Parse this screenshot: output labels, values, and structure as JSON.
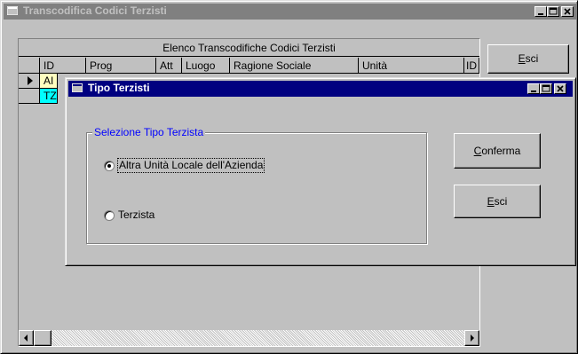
{
  "main_window": {
    "title": "Transcodifica Codici Terzisti",
    "grid_caption": "Elenco Transcodifiche Codici Terzisti",
    "columns": [
      "ID",
      "Prog",
      "Att",
      "Luogo",
      "Ragione Sociale",
      "Unità",
      "ID"
    ],
    "rows": [
      {
        "id": "AI",
        "color": "#ffffc0"
      },
      {
        "id": "TZ",
        "color": "#00ffff"
      }
    ],
    "esci_label": "Esci"
  },
  "dialog": {
    "title": "Tipo Terzisti",
    "group_label": "Selezione Tipo Terzista",
    "options": [
      {
        "label": "Altra Unità Locale dell'Azienda",
        "selected": true
      },
      {
        "label": "Terzista",
        "selected": false
      }
    ],
    "confirm_label": "Conferma",
    "exit_label": "Esci"
  }
}
